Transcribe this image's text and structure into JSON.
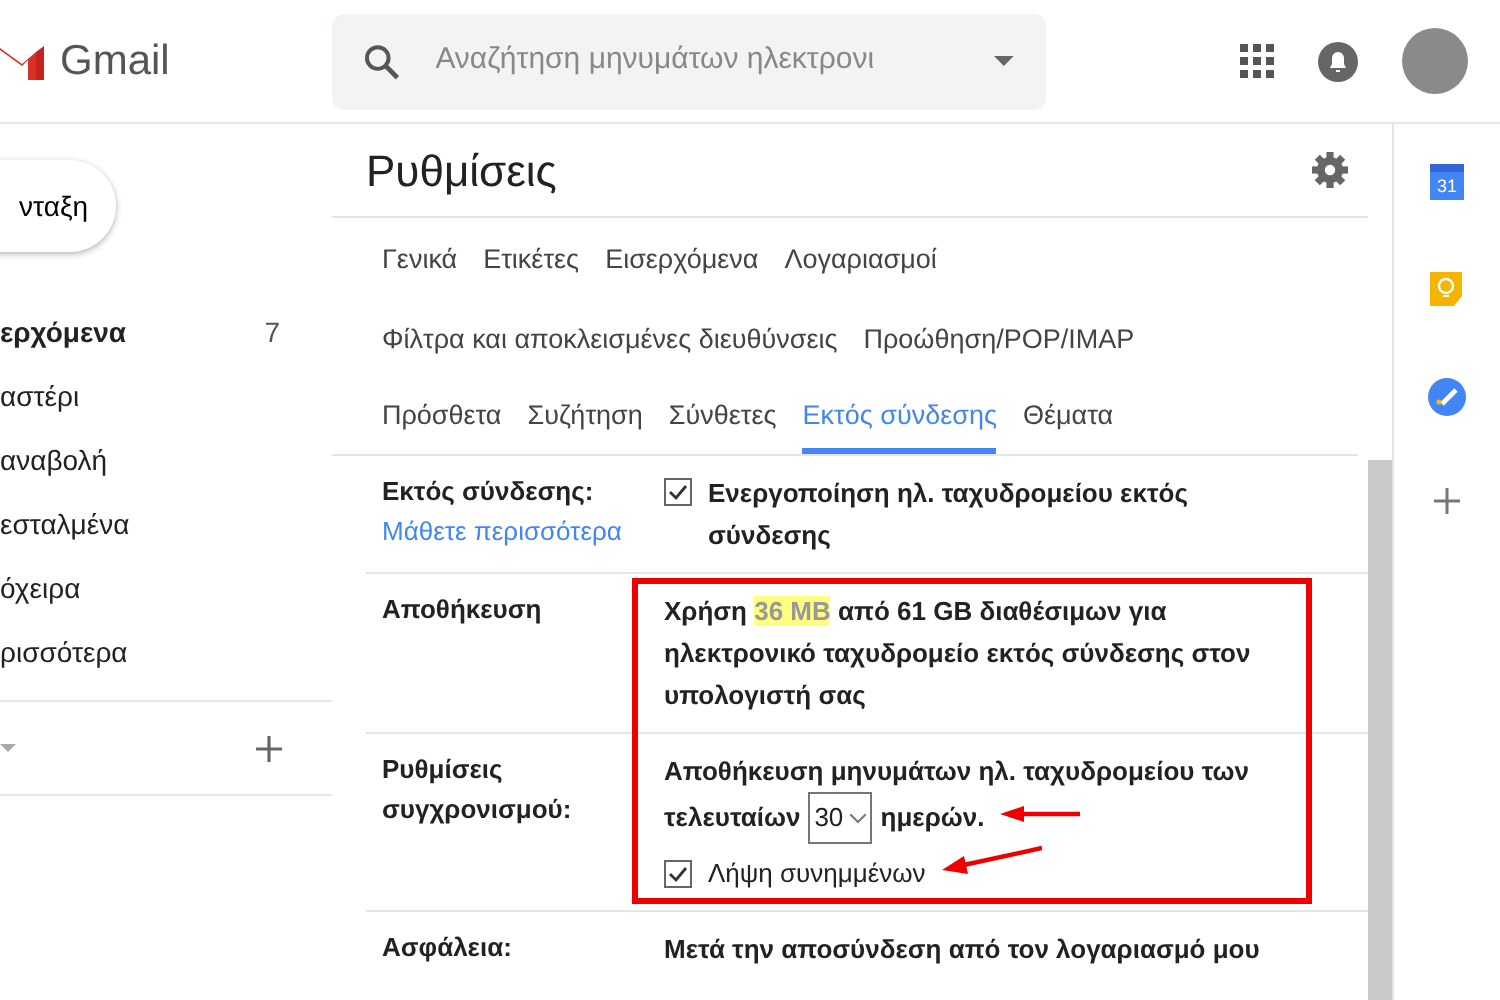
{
  "header": {
    "logo": "Gmail",
    "search_placeholder": "Αναζήτηση μηνυμάτων ηλεκτρονι"
  },
  "sidebar": {
    "compose": "νταξη",
    "items": [
      {
        "label": "ερχόμενα",
        "count": "7",
        "selected": true
      },
      {
        "label": "αστέρι",
        "selected": false
      },
      {
        "label": "αναβολή",
        "selected": false
      },
      {
        "label": "εσταλμένα",
        "selected": false
      },
      {
        "label": "όχειρα",
        "selected": false
      },
      {
        "label": "ρισσότερα",
        "selected": false
      }
    ]
  },
  "settings": {
    "title": "Ρυθμίσεις",
    "tab_rows": [
      [
        {
          "label": "Γενικά",
          "selected": false
        },
        {
          "label": "Ετικέτες",
          "selected": false
        },
        {
          "label": "Εισερχόμενα",
          "selected": false
        },
        {
          "label": "Λογαριασμοί",
          "selected": false
        }
      ],
      [
        {
          "label": "Φίλτρα και αποκλεισμένες διευθύνσεις",
          "selected": false
        },
        {
          "label": "Προώθηση/POP/IMAP",
          "selected": false
        }
      ],
      [
        {
          "label": "Πρόσθετα",
          "selected": false
        },
        {
          "label": "Συζήτηση",
          "selected": false
        },
        {
          "label": "Σύνθετες",
          "selected": false
        },
        {
          "label": "Εκτός σύνδεσης",
          "selected": true
        },
        {
          "label": "Θέματα",
          "selected": false
        }
      ]
    ],
    "rows": [
      {
        "kind": "offline",
        "label": "Εκτός σύνδεσης:",
        "link": "Μάθετε περισσότερα",
        "checkbox": {
          "label": "Ενεργοποίηση ηλ. ταχυδρομείου εκτός σύνδεσης",
          "checked": true
        }
      },
      {
        "kind": "storage",
        "label": "Αποθήκευση",
        "before": "Χρήση ",
        "highlight": "36 MB",
        "after": " από 61 GB διαθέσιμων για ηλεκτρονικό ταχυδρομείο εκτός σύνδεσης στον υπολογιστή σας"
      },
      {
        "kind": "sync",
        "label": "Ρυθμίσεις συγχρονισμού:",
        "text_line": "Αποθήκευση μηνυμάτων ηλ. ταχυδρομείου των",
        "text_before": "τελευταίων",
        "days": "30",
        "text_after": "ημερών.",
        "checkbox": {
          "label": "Λήψη συνημμένων",
          "checked": true
        }
      },
      {
        "kind": "security",
        "label": "Ασφάλεια:",
        "text": "Μετά την αποσύνδεση από τον λογαριασμό μου"
      }
    ]
  },
  "side_panel": {
    "calendar_day": "31"
  }
}
